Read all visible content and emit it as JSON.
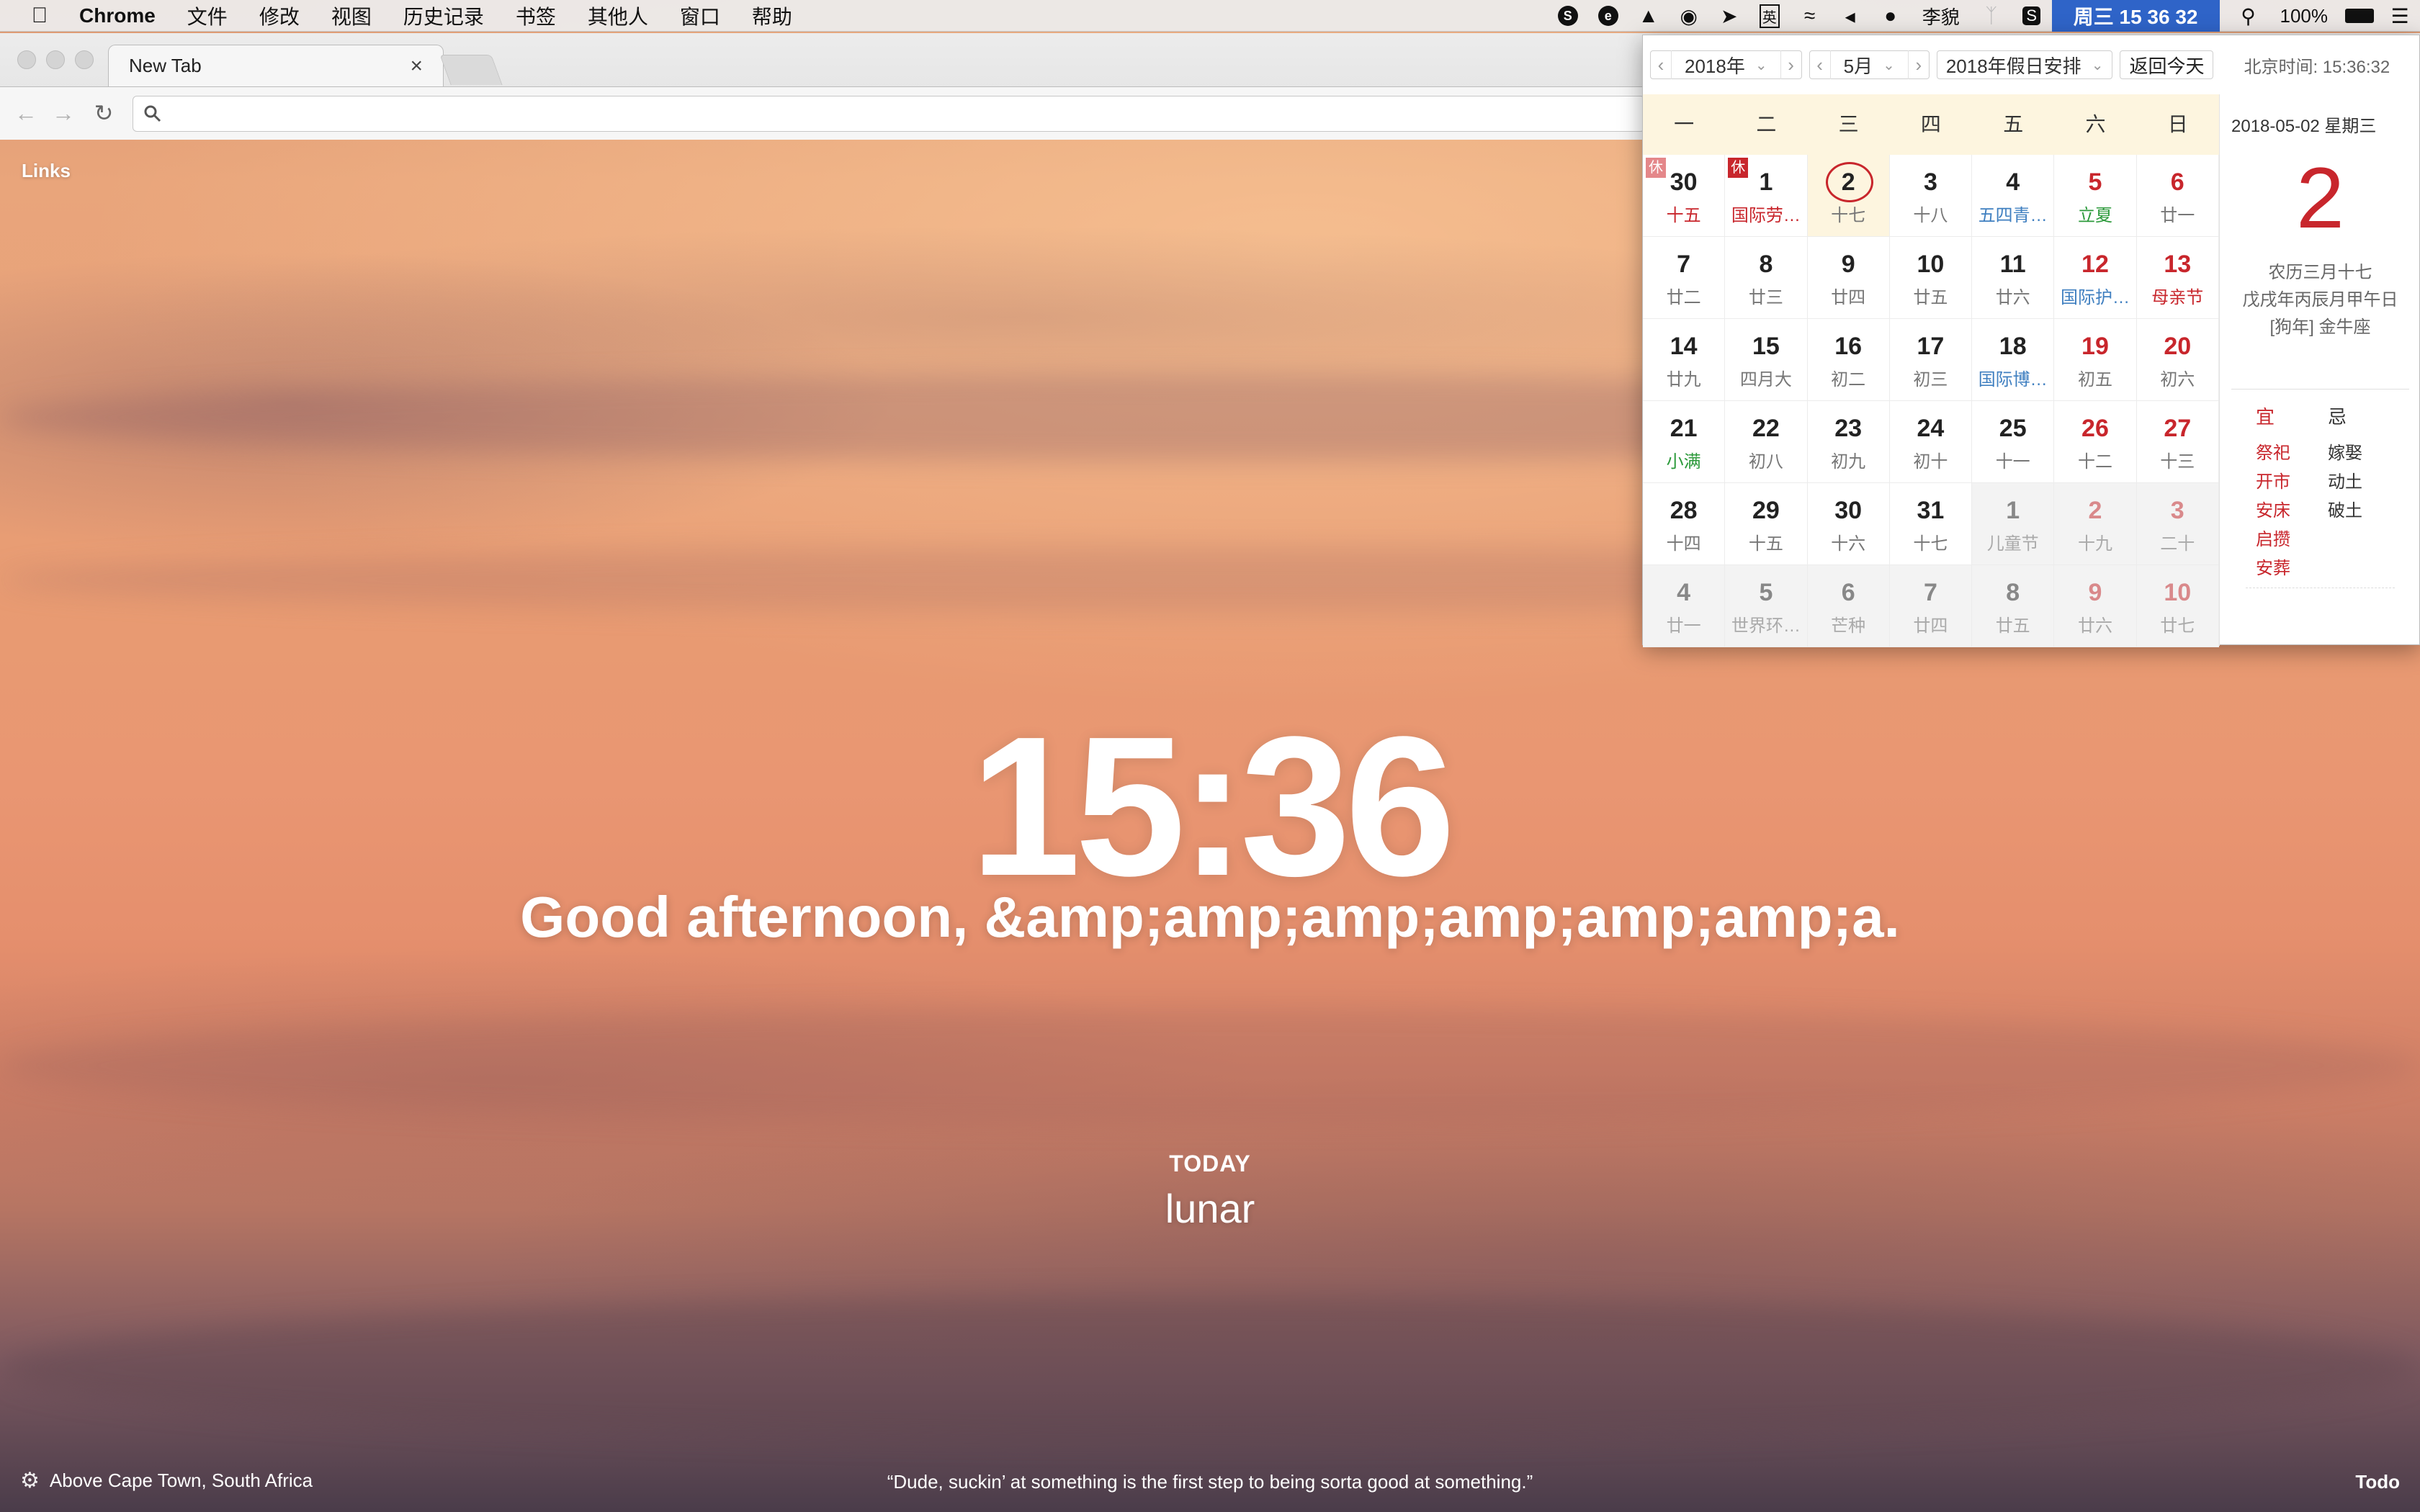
{
  "menubar": {
    "app": "Chrome",
    "items": [
      "文件",
      "修改",
      "视图",
      "历史记录",
      "书签",
      "其他人",
      "窗口",
      "帮助"
    ],
    "user": "李貌",
    "clock": "周三 15 36 32",
    "ime": "英",
    "battery": "100%"
  },
  "browser": {
    "tab_title": "New Tab",
    "tab_close": "×"
  },
  "momentum": {
    "links": "Links",
    "time": "15:36",
    "greeting": "Good afternoon, &amp;amp;amp;amp;amp;amp;a.",
    "today_label": "TODAY",
    "focus": "lunar",
    "location": "Above Cape Town, South Africa",
    "quote": "“Dude, suckin’ at something is the first step to being sorta good at something.”",
    "todo": "Todo"
  },
  "calendar": {
    "year": "2018年",
    "month": "5月",
    "holiday_select": "2018年假日安排",
    "back_today": "返回今天",
    "beijing_time": "北京时间: 15:36:32",
    "weekdays": [
      "一",
      "二",
      "三",
      "四",
      "五",
      "六",
      "日"
    ],
    "weeks": [
      [
        {
          "n": "30",
          "l": "十五",
          "lc": "fest",
          "o": false,
          "tag": "休",
          "tagc": "light"
        },
        {
          "n": "1",
          "l": "国际劳…",
          "lc": "fest",
          "tag": "休"
        },
        {
          "n": "2",
          "l": "十七",
          "sel": true
        },
        {
          "n": "3",
          "l": "十八"
        },
        {
          "n": "4",
          "l": "五四青…",
          "lc": "blue"
        },
        {
          "n": "5",
          "l": "立夏",
          "lc": "green",
          "we": true
        },
        {
          "n": "6",
          "l": "廿一",
          "we": true
        }
      ],
      [
        {
          "n": "7",
          "l": "廿二"
        },
        {
          "n": "8",
          "l": "廿三"
        },
        {
          "n": "9",
          "l": "廿四"
        },
        {
          "n": "10",
          "l": "廿五"
        },
        {
          "n": "11",
          "l": "廿六"
        },
        {
          "n": "12",
          "l": "国际护…",
          "lc": "blue",
          "we": true
        },
        {
          "n": "13",
          "l": "母亲节",
          "lc": "fest",
          "we": true
        }
      ],
      [
        {
          "n": "14",
          "l": "廿九"
        },
        {
          "n": "15",
          "l": "四月大"
        },
        {
          "n": "16",
          "l": "初二"
        },
        {
          "n": "17",
          "l": "初三"
        },
        {
          "n": "18",
          "l": "国际博…",
          "lc": "blue"
        },
        {
          "n": "19",
          "l": "初五",
          "we": true
        },
        {
          "n": "20",
          "l": "初六",
          "we": true
        }
      ],
      [
        {
          "n": "21",
          "l": "小满",
          "lc": "green"
        },
        {
          "n": "22",
          "l": "初八"
        },
        {
          "n": "23",
          "l": "初九"
        },
        {
          "n": "24",
          "l": "初十"
        },
        {
          "n": "25",
          "l": "十一"
        },
        {
          "n": "26",
          "l": "十二",
          "we": true
        },
        {
          "n": "27",
          "l": "十三",
          "we": true
        }
      ],
      [
        {
          "n": "28",
          "l": "十四"
        },
        {
          "n": "29",
          "l": "十五"
        },
        {
          "n": "30",
          "l": "十六"
        },
        {
          "n": "31",
          "l": "十七"
        },
        {
          "n": "1",
          "l": "儿童节",
          "lc": "fest",
          "o": true
        },
        {
          "n": "2",
          "l": "十九",
          "o": true,
          "we": true
        },
        {
          "n": "3",
          "l": "二十",
          "o": true,
          "we": true
        }
      ],
      [
        {
          "n": "4",
          "l": "廿一",
          "o": true
        },
        {
          "n": "5",
          "l": "世界环…",
          "lc": "blue",
          "o": true
        },
        {
          "n": "6",
          "l": "芒种",
          "lc": "green",
          "o": true
        },
        {
          "n": "7",
          "l": "廿四",
          "o": true
        },
        {
          "n": "8",
          "l": "廿五",
          "o": true
        },
        {
          "n": "9",
          "l": "廿六",
          "o": true,
          "we": true
        },
        {
          "n": "10",
          "l": "廿七",
          "o": true,
          "we": true
        }
      ]
    ],
    "side": {
      "date": "2018-05-02  星期三",
      "big_day": "2",
      "lunar1": "农历三月十七",
      "lunar2": "戊戌年丙辰月甲午日",
      "lunar3": "[狗年] 金牛座",
      "yi_label": "宜",
      "ji_label": "忌",
      "yi": [
        "祭祀",
        "开市",
        "安床",
        "启攒",
        "安葬"
      ],
      "ji": [
        "嫁娶",
        "动土",
        "破土"
      ],
      "yi_color": "#c8262c"
    }
  }
}
